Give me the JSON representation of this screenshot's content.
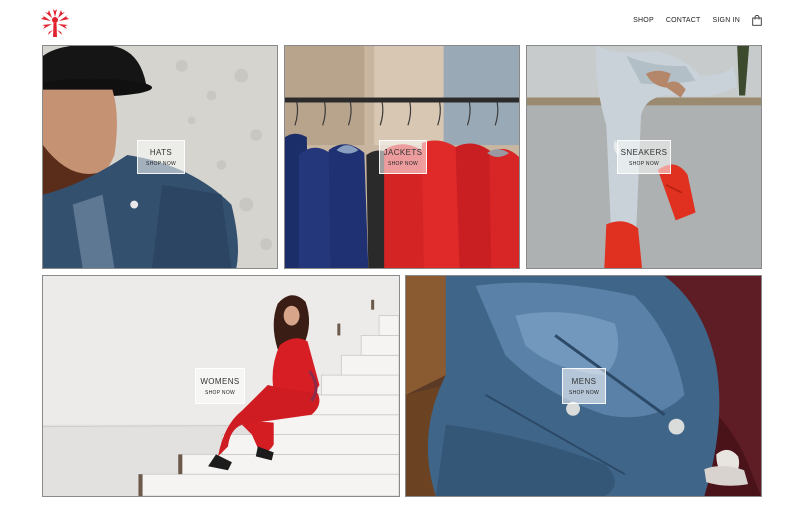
{
  "header": {
    "logo_icon": "tree-logo-icon",
    "brand_color": "#e0222f",
    "nav": [
      {
        "label": "SHOP"
      },
      {
        "label": "CONTACT"
      },
      {
        "label": "SIGN IN"
      }
    ],
    "cart_icon": "shopping-bag-icon"
  },
  "categories": [
    {
      "title": "HATS",
      "cta": "SHOP NOW"
    },
    {
      "title": "JACKETS",
      "cta": "SHOP NOW"
    },
    {
      "title": "SNEAKERS",
      "cta": "SHOP NOW"
    },
    {
      "title": "WOMENS",
      "cta": "SHOP NOW"
    },
    {
      "title": "MENS",
      "cta": "SHOP NOW"
    }
  ]
}
